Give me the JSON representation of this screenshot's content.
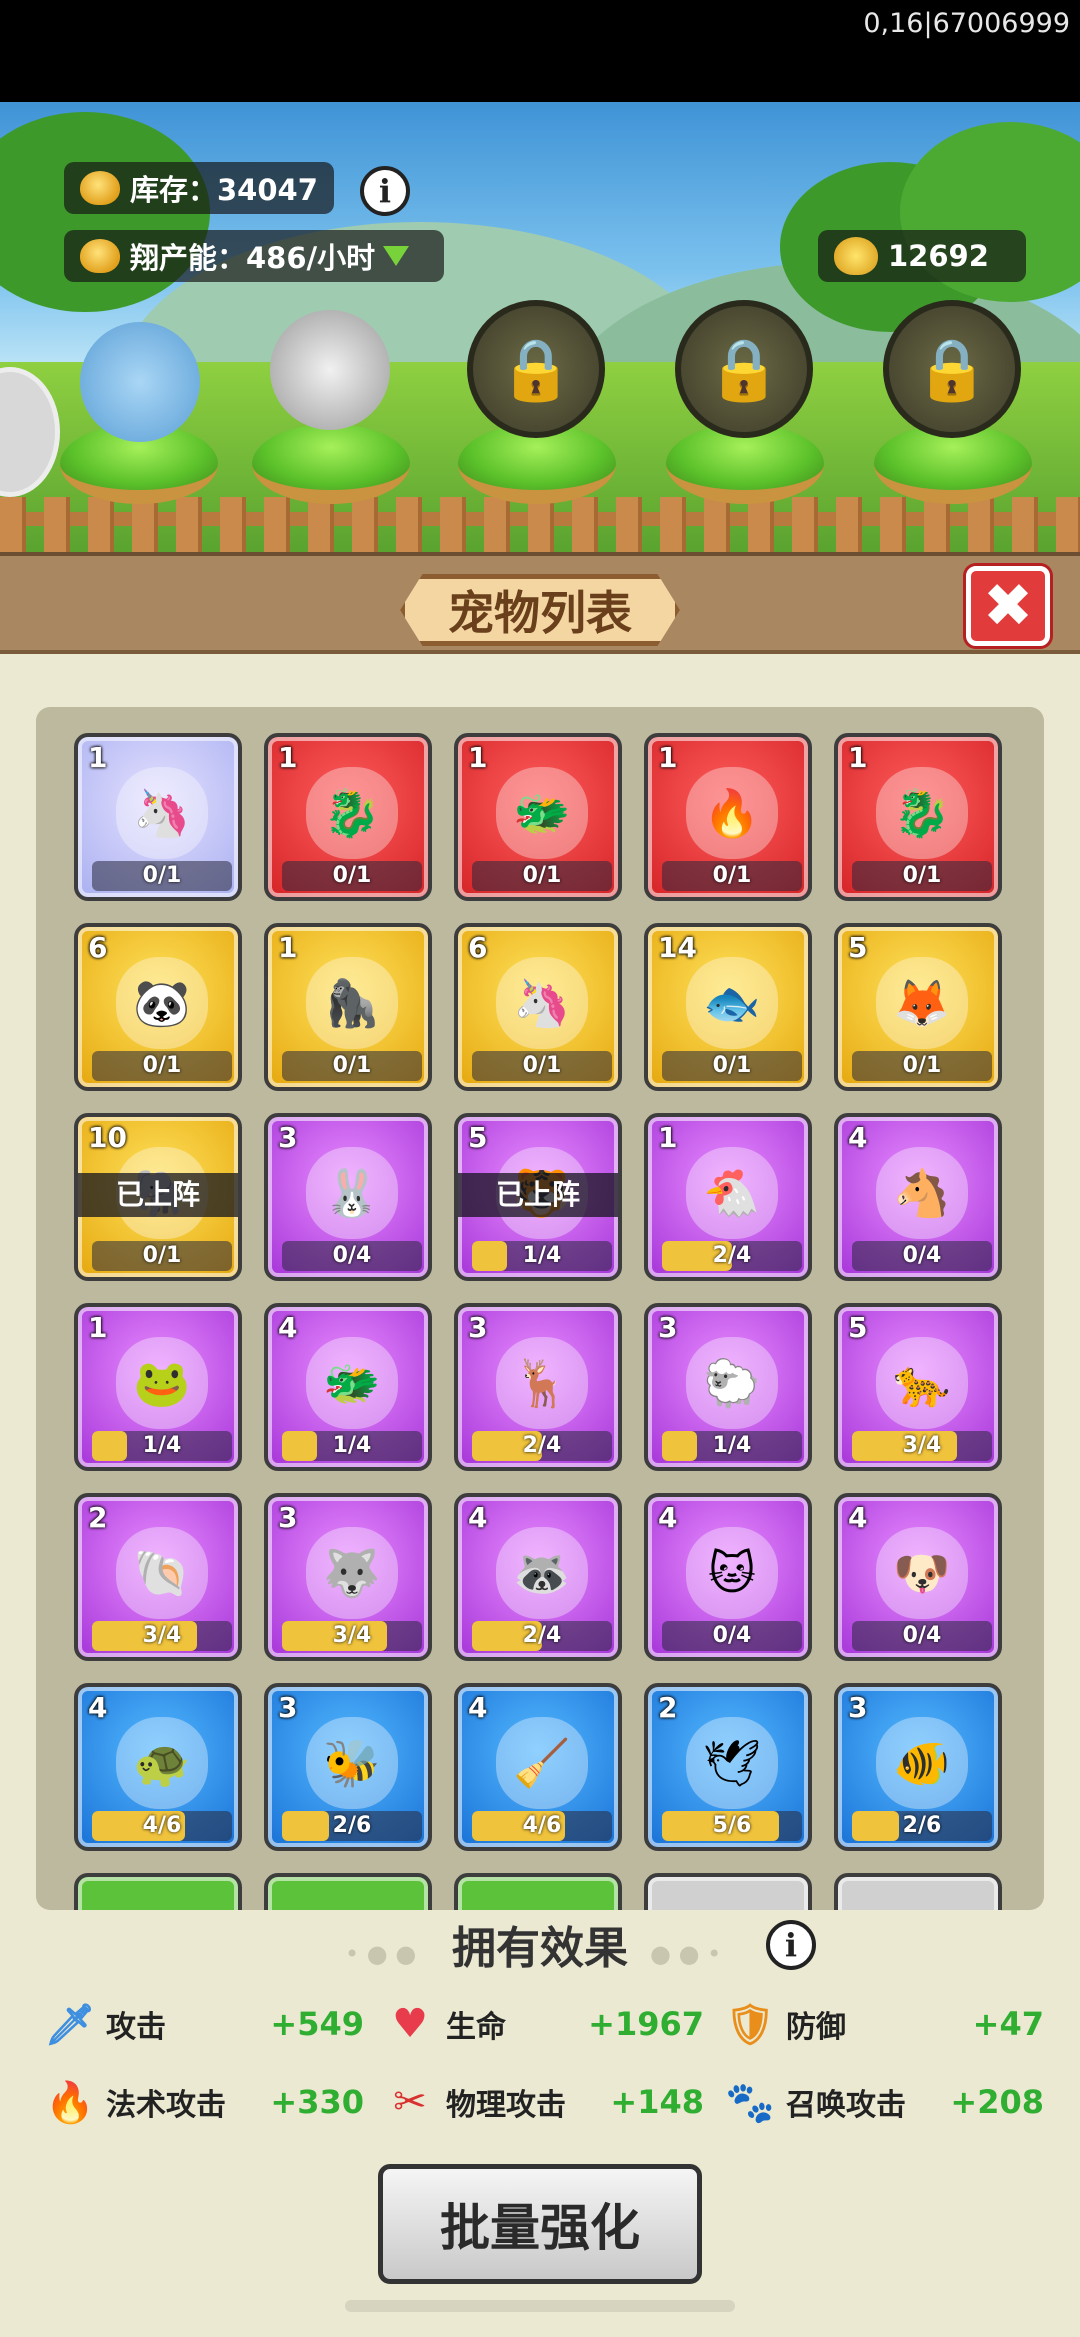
{
  "status": {
    "debug_text": "0,16|67006999"
  },
  "resources": {
    "stock_label": "库存：34047",
    "production_label": "翔产能：486/小时",
    "gold_value": "12692"
  },
  "panel": {
    "title": "宠物列表",
    "close_glyph": "✖"
  },
  "pets": [
    {
      "level": "1",
      "progress": "0/1",
      "fill": 0,
      "rarity": "lilac",
      "icon": "qilin-icon",
      "deployed": false
    },
    {
      "level": "1",
      "progress": "0/1",
      "fill": 0,
      "rarity": "red",
      "icon": "leaf-dragon-icon",
      "deployed": false
    },
    {
      "level": "1",
      "progress": "0/1",
      "fill": 0,
      "rarity": "red",
      "icon": "azure-dragon-icon",
      "deployed": false
    },
    {
      "level": "1",
      "progress": "0/1",
      "fill": 0,
      "rarity": "red",
      "icon": "phoenix-icon",
      "deployed": false
    },
    {
      "level": "1",
      "progress": "0/1",
      "fill": 0,
      "rarity": "red",
      "icon": "green-dragon-icon",
      "deployed": false
    },
    {
      "level": "6",
      "progress": "0/1",
      "fill": 0,
      "rarity": "gold",
      "icon": "panda-icon",
      "deployed": false
    },
    {
      "level": "1",
      "progress": "0/1",
      "fill": 0,
      "rarity": "gold",
      "icon": "gorilla-icon",
      "deployed": false
    },
    {
      "level": "6",
      "progress": "0/1",
      "fill": 0,
      "rarity": "gold",
      "icon": "unicorn-icon",
      "deployed": false
    },
    {
      "level": "14",
      "progress": "0/1",
      "fill": 0,
      "rarity": "gold",
      "icon": "red-fish-icon",
      "deployed": false
    },
    {
      "level": "5",
      "progress": "0/1",
      "fill": 0,
      "rarity": "gold",
      "icon": "white-fox-icon",
      "deployed": false
    },
    {
      "level": "10",
      "progress": "0/1",
      "fill": 0,
      "rarity": "gold",
      "icon": "elephant-icon",
      "deployed": true
    },
    {
      "level": "3",
      "progress": "0/4",
      "fill": 0,
      "rarity": "purple",
      "icon": "rabbit-icon",
      "deployed": false
    },
    {
      "level": "5",
      "progress": "1/4",
      "fill": 0.25,
      "rarity": "purple",
      "icon": "snow-leopard-icon",
      "deployed": true
    },
    {
      "level": "1",
      "progress": "2/4",
      "fill": 0.5,
      "rarity": "purple",
      "icon": "chicken-icon",
      "deployed": false
    },
    {
      "level": "4",
      "progress": "0/4",
      "fill": 0,
      "rarity": "purple",
      "icon": "horse-icon",
      "deployed": false
    },
    {
      "level": "1",
      "progress": "1/4",
      "fill": 0.25,
      "rarity": "purple",
      "icon": "frog-icon",
      "deployed": false
    },
    {
      "level": "4",
      "progress": "1/4",
      "fill": 0.25,
      "rarity": "purple",
      "icon": "red-dragon-icon",
      "deployed": false
    },
    {
      "level": "3",
      "progress": "2/4",
      "fill": 0.5,
      "rarity": "purple",
      "icon": "deer-icon",
      "deployed": false
    },
    {
      "level": "3",
      "progress": "1/4",
      "fill": 0.25,
      "rarity": "purple",
      "icon": "sheep-icon",
      "deployed": false
    },
    {
      "level": "5",
      "progress": "3/4",
      "fill": 0.75,
      "rarity": "purple",
      "icon": "leopard-icon",
      "deployed": false
    },
    {
      "level": "2",
      "progress": "3/4",
      "fill": 0.75,
      "rarity": "purple",
      "icon": "clam-icon",
      "deployed": false
    },
    {
      "level": "3",
      "progress": "3/4",
      "fill": 0.75,
      "rarity": "purple",
      "icon": "wolf-icon",
      "deployed": false
    },
    {
      "level": "4",
      "progress": "2/4",
      "fill": 0.5,
      "rarity": "purple",
      "icon": "red-panda-icon",
      "deployed": false
    },
    {
      "level": "4",
      "progress": "0/4",
      "fill": 0,
      "rarity": "purple",
      "icon": "cat-icon",
      "deployed": false
    },
    {
      "level": "4",
      "progress": "0/4",
      "fill": 0,
      "rarity": "purple",
      "icon": "dog-icon",
      "deployed": false
    },
    {
      "level": "4",
      "progress": "4/6",
      "fill": 0.667,
      "rarity": "blue",
      "icon": "turtle-icon",
      "deployed": false
    },
    {
      "level": "3",
      "progress": "2/6",
      "fill": 0.333,
      "rarity": "blue",
      "icon": "bee-icon",
      "deployed": false
    },
    {
      "level": "4",
      "progress": "4/6",
      "fill": 0.667,
      "rarity": "blue",
      "icon": "broom-icon",
      "deployed": false
    },
    {
      "level": "2",
      "progress": "5/6",
      "fill": 0.833,
      "rarity": "blue",
      "icon": "dove-icon",
      "deployed": false
    },
    {
      "level": "3",
      "progress": "2/6",
      "fill": 0.333,
      "rarity": "blue",
      "icon": "goldfish-bowl-icon",
      "deployed": false
    }
  ],
  "deployed_label": "已上阵",
  "effects": {
    "title": "拥有效果",
    "items": [
      {
        "label": "攻击",
        "value": "+549",
        "icon": "sword-icon",
        "glyph": "🗡"
      },
      {
        "label": "生命",
        "value": "+1967",
        "icon": "heart-icon",
        "glyph": "♥"
      },
      {
        "label": "防御",
        "value": "+47",
        "icon": "shield-icon",
        "glyph": "🛡"
      },
      {
        "label": "法术攻击",
        "value": "+330",
        "icon": "flame-icon",
        "glyph": "🔥"
      },
      {
        "label": "物理攻击",
        "value": "+148",
        "icon": "claw-icon",
        "glyph": "✂"
      },
      {
        "label": "召唤攻击",
        "value": "+208",
        "icon": "paw-icon",
        "glyph": "🐾"
      }
    ]
  },
  "batch_button": "批量强化",
  "colors": {
    "accent_green": "#2fae32",
    "close_red": "#e23b3b"
  }
}
